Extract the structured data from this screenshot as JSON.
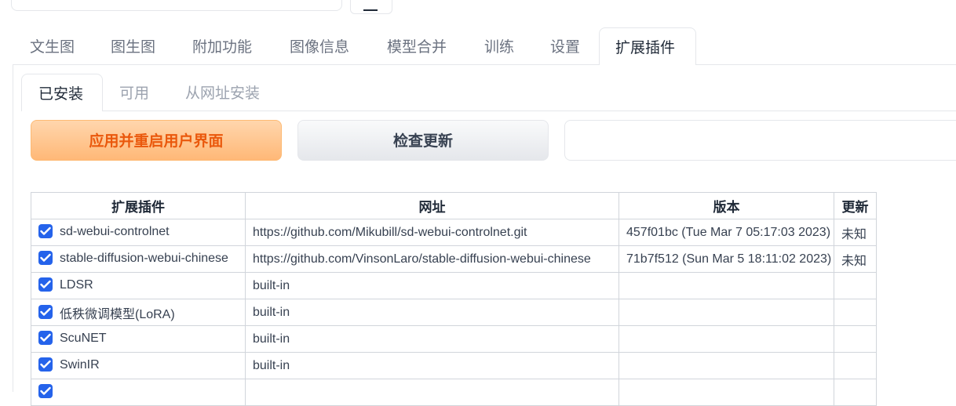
{
  "main_tabs": [
    "文生图",
    "图生图",
    "附加功能",
    "图像信息",
    "模型合并",
    "训练",
    "设置",
    "扩展插件"
  ],
  "main_tab_active": "扩展插件",
  "sub_tabs": [
    "已安装",
    "可用",
    "从网址安装"
  ],
  "sub_tab_active": "已安装",
  "buttons": {
    "apply_restart": "应用并重启用户界面",
    "check_updates": "检查更新"
  },
  "table": {
    "headers": [
      "扩展插件",
      "网址",
      "版本",
      "更新"
    ],
    "rows": [
      {
        "name": "sd-webui-controlnet",
        "url": "https://github.com/Mikubill/sd-webui-controlnet.git",
        "version": "457f01bc (Tue Mar 7 05:17:03 2023)",
        "update": "未知",
        "checked": true
      },
      {
        "name": "stable-diffusion-webui-chinese",
        "url": "https://github.com/VinsonLaro/stable-diffusion-webui-chinese",
        "version": "71b7f512 (Sun Mar 5 18:11:02 2023)",
        "update": "未知",
        "checked": true
      },
      {
        "name": "LDSR",
        "url": "built-in",
        "version": "",
        "update": "",
        "checked": true
      },
      {
        "name": "低秩微调模型(LoRA)",
        "url": "built-in",
        "version": "",
        "update": "",
        "checked": true
      },
      {
        "name": "ScuNET",
        "url": "built-in",
        "version": "",
        "update": "",
        "checked": true
      },
      {
        "name": "SwinIR",
        "url": "built-in",
        "version": "",
        "update": "",
        "checked": true
      },
      {
        "name": "",
        "url": "",
        "version": "",
        "update": "",
        "checked": true
      }
    ]
  },
  "colors": {
    "primary_text": "#ea580c",
    "checkbox": "#2563eb"
  }
}
